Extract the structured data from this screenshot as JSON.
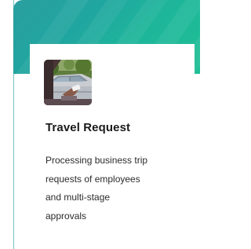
{
  "card": {
    "title": "Travel Request",
    "description_lines": [
      "Processing business trip",
      "requests of employees",
      "and multi-stage",
      "approvals"
    ]
  },
  "colors": {
    "banner_start": "#2a9fa0",
    "banner_end": "#1fbf95",
    "title_text": "#1a1a1a",
    "body_text": "#2b2b2b"
  },
  "icons": {
    "thumbnail": "car-window-photo"
  }
}
